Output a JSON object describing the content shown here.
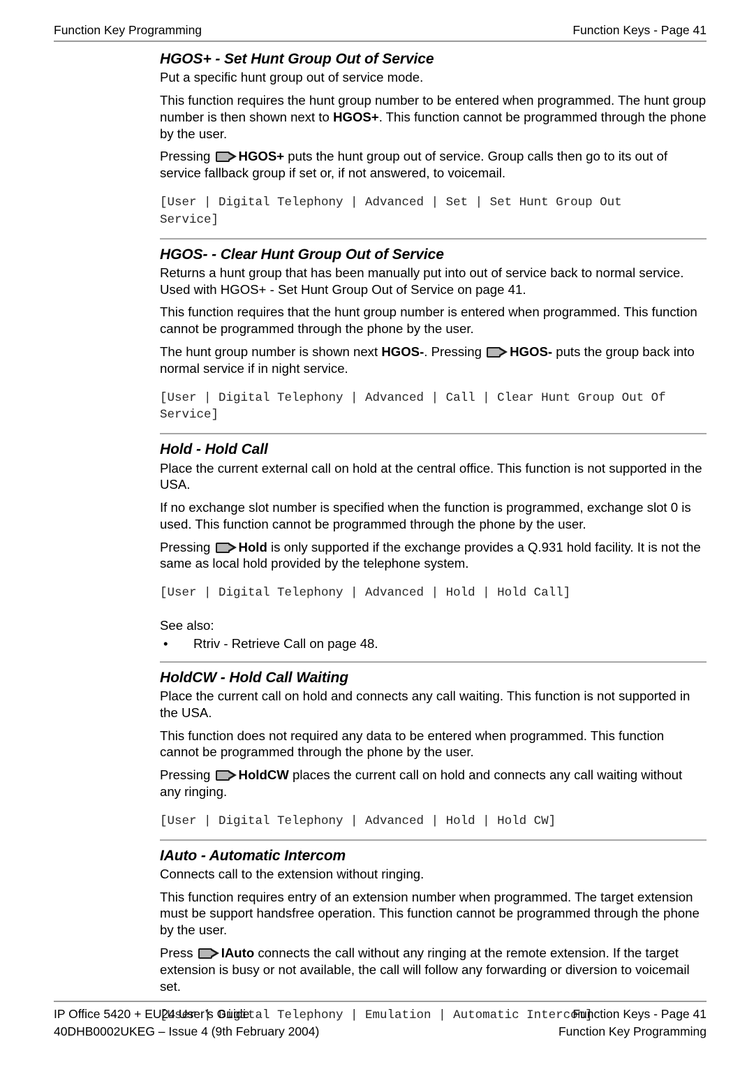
{
  "header": {
    "left": "Function Key Programming",
    "right": "Function Keys - Page 41"
  },
  "footer": {
    "line1_left": "IP Office 5420 + EU24 User’s Guide",
    "line2_left": "40DHB0002UKEG – Issue 4 (9th February 2004)",
    "line1_right": "Function Keys - Page 41",
    "line2_right": "Function Key Programming"
  },
  "sections": [
    {
      "title": "HGOS+ - Set Hunt Group Out of Service",
      "intro": "Put a specific hunt group out of service mode.",
      "para2_a": "This function requires the hunt group number to be entered when programmed. The hunt group number is then shown next to ",
      "para2_bold": "HGOS+",
      "para2_b": ". This function cannot be programmed through the phone by the user.",
      "para3_a": "Pressing ",
      "para3_bold": "HGOS+",
      "para3_b": " puts the hunt group out of service. Group calls then go to its out of service fallback group if set or, if not answered, to voicemail.",
      "path": "[User | Digital Telephony | Advanced | Set | Set Hunt Group Out\nService]"
    },
    {
      "title": "HGOS- - Clear Hunt Group Out of Service",
      "intro": "Returns a hunt group that has been manually put into out of service back to normal service. Used with HGOS+ - Set Hunt Group Out of Service on page 41.",
      "para2": "This function requires that the hunt group number is entered when programmed. This function cannot be programmed through the phone by the user.",
      "para3_a": "The hunt group number is shown next ",
      "para3_bold1": "HGOS-",
      "para3_mid": ". Pressing ",
      "para3_bold2": "HGOS-",
      "para3_b": " puts the group back into normal service if in night service.",
      "path": "[User | Digital Telephony | Advanced | Call | Clear Hunt Group Out Of\nService]"
    },
    {
      "title": "Hold - Hold Call",
      "intro": "Place the current external call on hold at the central office. This function is not supported in the USA.",
      "para2": "If no exchange slot number is specified when the function is programmed, exchange slot 0 is used. This function cannot be programmed through the phone by the user.",
      "para3_a": "Pressing ",
      "para3_bold": "Hold",
      "para3_b": " is only supported if the exchange provides a Q.931 hold facility. It is not the same as local hold provided by the telephone system.",
      "path": "[User | Digital Telephony | Advanced | Hold | Hold Call]",
      "seealso_label": "See also:",
      "seealso_items": [
        "Rtriv - Retrieve Call on page 48."
      ],
      "bullet_glyph": "•"
    },
    {
      "title": "HoldCW - Hold Call Waiting",
      "intro": "Place the current call on hold and connects any call waiting. This function is not supported in the USA.",
      "para2": "This function does not required any data to be entered when programmed. This function cannot be programmed through the phone by the user.",
      "para3_a": "Pressing ",
      "para3_bold": "HoldCW",
      "para3_b": " places the current call on hold and connects any call waiting without any ringing.",
      "path": "[User | Digital Telephony | Advanced | Hold | Hold CW]"
    },
    {
      "title": "IAuto - Automatic Intercom",
      "intro": "Connects call to the extension without ringing.",
      "para2": "This function requires entry of an extension number when programmed. The target extension must be support handsfree operation. This function cannot be programmed through the phone by the user.",
      "para3_a": "Press ",
      "para3_bold": "IAuto",
      "para3_b": " connects the call without any ringing at the remote extension. If the target extension is busy or not available, the call will follow any forwarding or diversion to voicemail set.",
      "path": "[User | Digital Telephony | Emulation | Automatic Intercom]"
    }
  ]
}
